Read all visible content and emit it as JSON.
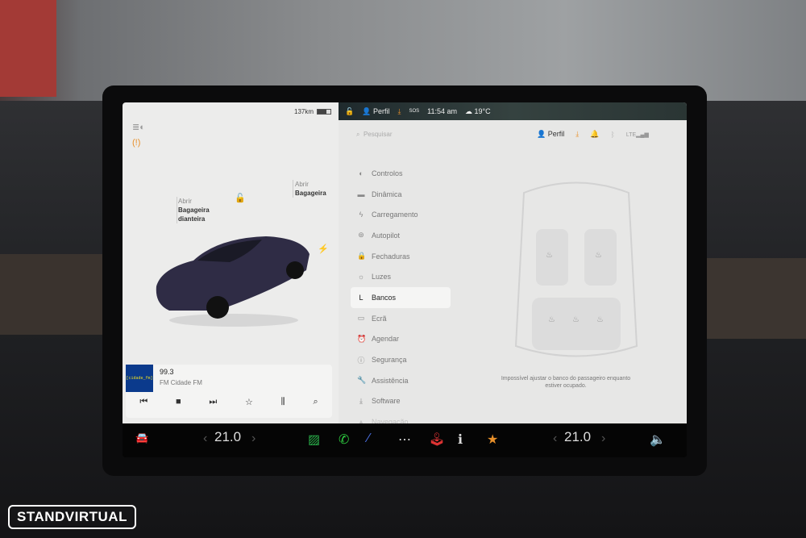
{
  "status": {
    "range": "137km",
    "profile": "Perfil",
    "time": "11:54 am",
    "temp": "19°C",
    "sos": "SOS"
  },
  "car": {
    "front_trunk_action": "Abrir",
    "front_trunk_label": "Bagageira dianteira",
    "trunk_action": "Abrir",
    "trunk_label": "Bagageira"
  },
  "media": {
    "logo": "[cidade_fm]",
    "frequency": "99.3",
    "station": "FM Cidade FM"
  },
  "search": {
    "placeholder": "Pesquisar"
  },
  "header": {
    "profile": "Perfil"
  },
  "nav": [
    {
      "label": "Controlos",
      "icon": "toggle-icon"
    },
    {
      "label": "Dinâmica",
      "icon": "car-icon"
    },
    {
      "label": "Carregamento",
      "icon": "bolt-icon"
    },
    {
      "label": "Autopilot",
      "icon": "steering-wheel-icon"
    },
    {
      "label": "Fechaduras",
      "icon": "lock-icon"
    },
    {
      "label": "Luzes",
      "icon": "sun-icon"
    },
    {
      "label": "Bancos",
      "icon": "seat-icon"
    },
    {
      "label": "Ecrã",
      "icon": "display-icon"
    },
    {
      "label": "Agendar",
      "icon": "alarm-icon"
    },
    {
      "label": "Segurança",
      "icon": "shield-icon"
    },
    {
      "label": "Assistência",
      "icon": "wrench-icon"
    },
    {
      "label": "Software",
      "icon": "download-icon"
    },
    {
      "label": "Navegação",
      "icon": "navigation-icon"
    }
  ],
  "seat_message": "Impossível ajustar o banco do passageiro enquanto estiver ocupado.",
  "climate": {
    "driver_temp": "21.0",
    "passenger_temp": "21.0"
  },
  "watermark": "STANDVIRTUAL",
  "colors": {
    "accent_orange": "#e8902a",
    "active_nav": "#f5f5f4"
  }
}
